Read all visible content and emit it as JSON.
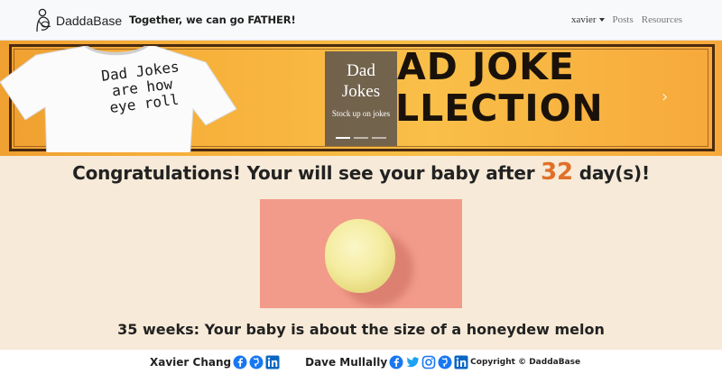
{
  "navbar": {
    "brand": "DaddaBase",
    "tagline": "Together, we can go FATHER!",
    "user": "xavier",
    "links": [
      "Posts",
      "Resources"
    ]
  },
  "banner": {
    "shirt_text": [
      "Dad Jokes",
      "are how",
      "eye roll"
    ],
    "headline_line1": "AD JOKE",
    "headline_line2": "LLECTION",
    "caption_title_line1": "Dad",
    "caption_title_line2": "Jokes",
    "caption_sub": "Stock up on jokes",
    "slide_count": 3,
    "active_slide": 1
  },
  "main": {
    "congrats_prefix": "Congratulations! Your will see your baby after",
    "days": "32",
    "congrats_suffix": "day(s)!",
    "size_text": "35 weeks: Your baby is about the size of a honeydew melon"
  },
  "footer": {
    "person1": "Xavier Chang",
    "person2": "Dave Mullally",
    "copyright": "Copyright © DaddaBase"
  },
  "colors": {
    "accent": "#e07028",
    "fruit_bg": "#f29b8a",
    "banner": "#f7b23c",
    "facebook": "#1877f2",
    "twitter": "#1da1f2",
    "linkedin": "#0a66c2"
  }
}
